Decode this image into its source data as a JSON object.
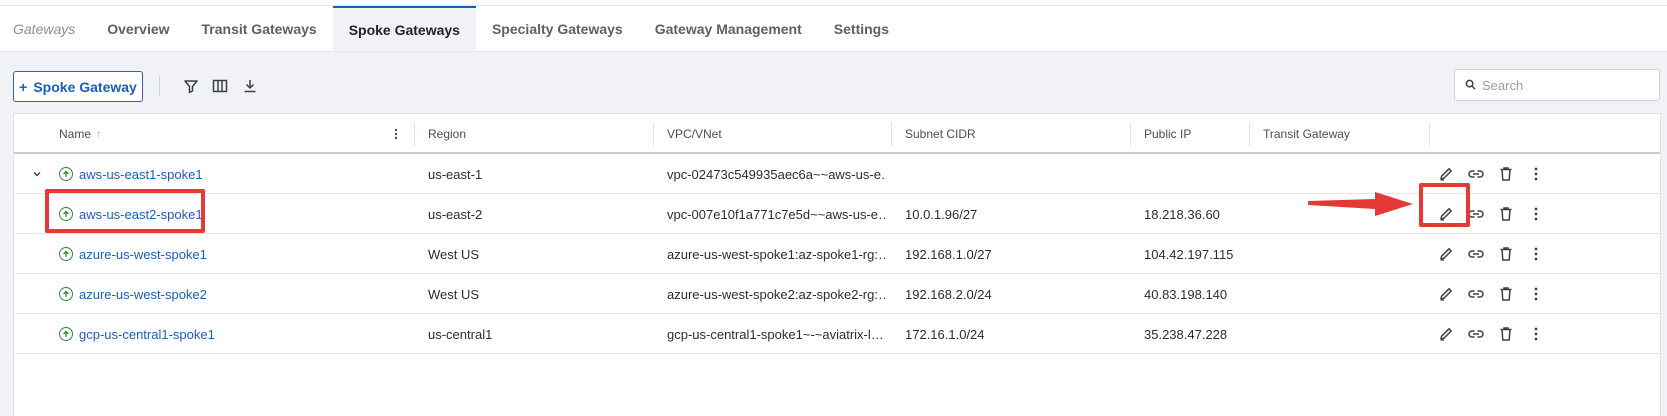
{
  "tabs": [
    {
      "label": "Gateways"
    },
    {
      "label": "Overview"
    },
    {
      "label": "Transit Gateways"
    },
    {
      "label": "Spoke Gateways"
    },
    {
      "label": "Specialty Gateways"
    },
    {
      "label": "Gateway Management"
    },
    {
      "label": "Settings"
    }
  ],
  "active_tab": "Spoke Gateways",
  "toolbar": {
    "add_label": "Spoke Gateway",
    "add_prefix": "+",
    "icons": [
      "filter-icon",
      "columns-icon",
      "download-icon"
    ]
  },
  "search": {
    "placeholder": "Search",
    "value": ""
  },
  "table": {
    "columns": [
      "Name",
      "Region",
      "VPC/VNet",
      "Subnet CIDR",
      "Public IP",
      "Transit Gateway"
    ],
    "sort": {
      "column": "Name",
      "direction": "ascending"
    },
    "rows": [
      {
        "name": "aws-us-east1-spoke1",
        "region": "us-east-1",
        "vpc": "vpc-02473c549935aec6a~~aws-us-e…",
        "subnet": "",
        "public_ip": "",
        "transit": "",
        "expandable": true
      },
      {
        "name": "aws-us-east2-spoke1",
        "region": "us-east-2",
        "vpc": "vpc-007e10f1a771c7e5d~~aws-us-e…",
        "subnet": "10.0.1.96/27",
        "public_ip": "18.218.36.60",
        "transit": ""
      },
      {
        "name": "azure-us-west-spoke1",
        "region": "West US",
        "vpc": "azure-us-west-spoke1:az-spoke1-rg:…",
        "subnet": "192.168.1.0/27",
        "public_ip": "104.42.197.115",
        "transit": ""
      },
      {
        "name": "azure-us-west-spoke2",
        "region": "West US",
        "vpc": "azure-us-west-spoke2:az-spoke2-rg:…",
        "subnet": "192.168.2.0/24",
        "public_ip": "40.83.198.140",
        "transit": ""
      },
      {
        "name": "gcp-us-central1-spoke1",
        "region": "us-central1",
        "vpc": "gcp-us-central1-spoke1~-~aviatrix-l…",
        "subnet": "172.16.1.0/24",
        "public_ip": "35.238.47.228",
        "transit": ""
      }
    ],
    "row_actions": [
      "edit-icon",
      "link-icon",
      "delete-icon",
      "more-icon"
    ]
  },
  "colors": {
    "accent": "#1d5fb3",
    "status_ok": "#2e8b3a",
    "annotation": "#e53935"
  }
}
